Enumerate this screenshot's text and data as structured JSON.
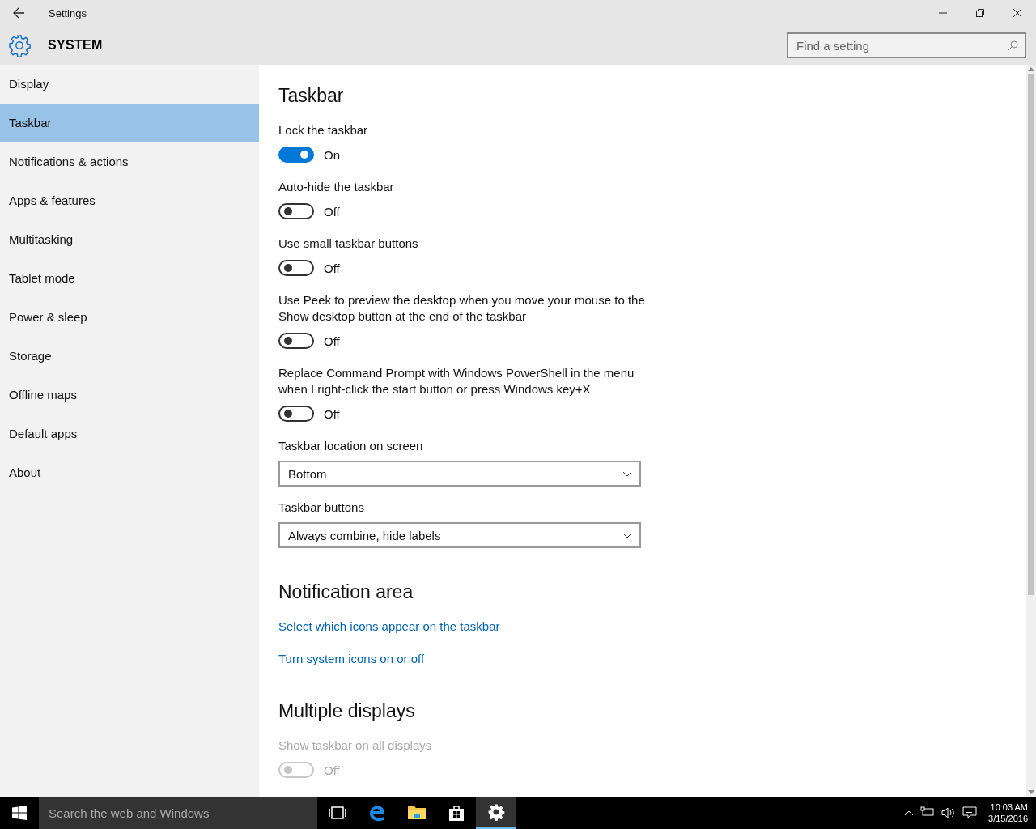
{
  "window": {
    "title": "Settings"
  },
  "header": {
    "title": "SYSTEM"
  },
  "search": {
    "placeholder": "Find a setting"
  },
  "sidebar": {
    "items": [
      {
        "label": "Display",
        "selected": false
      },
      {
        "label": "Taskbar",
        "selected": true
      },
      {
        "label": "Notifications & actions",
        "selected": false
      },
      {
        "label": "Apps & features",
        "selected": false
      },
      {
        "label": "Multitasking",
        "selected": false
      },
      {
        "label": "Tablet mode",
        "selected": false
      },
      {
        "label": "Power & sleep",
        "selected": false
      },
      {
        "label": "Storage",
        "selected": false
      },
      {
        "label": "Offline maps",
        "selected": false
      },
      {
        "label": "Default apps",
        "selected": false
      },
      {
        "label": "About",
        "selected": false
      }
    ]
  },
  "content": [
    {
      "kind": "heading",
      "text": "Taskbar"
    },
    {
      "kind": "toggle",
      "label": "Lock the taskbar",
      "on": true,
      "disabled": false,
      "state_text": "On"
    },
    {
      "kind": "toggle",
      "label": "Auto-hide the taskbar",
      "on": false,
      "disabled": false,
      "state_text": "Off"
    },
    {
      "kind": "toggle",
      "label": "Use small taskbar buttons",
      "on": false,
      "disabled": false,
      "state_text": "Off"
    },
    {
      "kind": "toggle",
      "label": "Use Peek to preview the desktop when you move your mouse to the Show desktop button at the end of the taskbar",
      "on": false,
      "disabled": false,
      "state_text": "Off"
    },
    {
      "kind": "toggle",
      "label": "Replace Command Prompt with Windows PowerShell in the menu when I right-click the start button or press Windows key+X",
      "on": false,
      "disabled": false,
      "state_text": "Off"
    },
    {
      "kind": "dropdown",
      "label": "Taskbar location on screen",
      "value": "Bottom"
    },
    {
      "kind": "dropdown",
      "label": "Taskbar buttons",
      "value": "Always combine, hide labels"
    },
    {
      "kind": "heading",
      "text": "Notification area"
    },
    {
      "kind": "link",
      "text": "Select which icons appear on the taskbar"
    },
    {
      "kind": "link",
      "text": "Turn system icons on or off"
    },
    {
      "kind": "heading",
      "text": "Multiple displays"
    },
    {
      "kind": "toggle",
      "label": "Show taskbar on all displays",
      "on": false,
      "disabled": true,
      "state_text": "Off"
    }
  ],
  "taskbar": {
    "search_placeholder": "Search the web and Windows",
    "apps": [
      {
        "kind": "task-view",
        "active": false
      },
      {
        "kind": "browser",
        "active": false
      },
      {
        "kind": "folder",
        "active": false
      },
      {
        "kind": "store",
        "active": false
      },
      {
        "kind": "settings",
        "active": true
      }
    ],
    "time": "10:03 AM",
    "date": "3/15/2016"
  }
}
